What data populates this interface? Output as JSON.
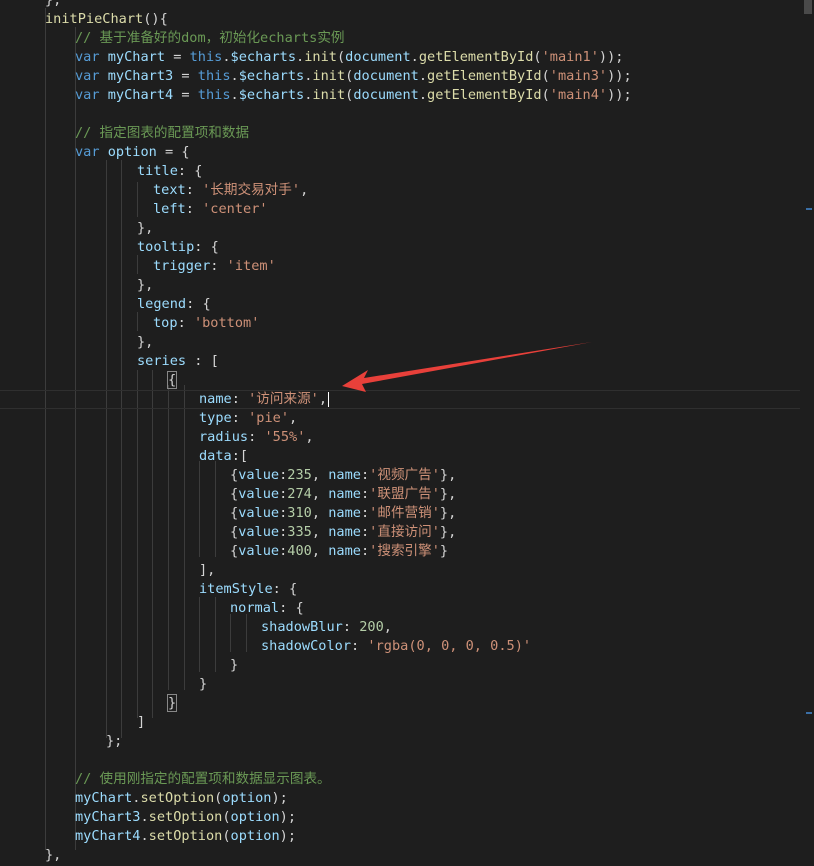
{
  "lines": [
    [
      {
        "t": "},",
        "c": "punc"
      }
    ],
    [
      {
        "t": "initPieChart",
        "c": "fn"
      },
      {
        "t": "(){",
        "c": "punc"
      }
    ],
    [
      {
        "t": "// 基于准备好的dom，初始化echarts实例",
        "c": "cmt"
      }
    ],
    [
      {
        "t": "var ",
        "c": "kw"
      },
      {
        "t": "myChart",
        "c": "var"
      },
      {
        "t": " = ",
        "c": "punc"
      },
      {
        "t": "this",
        "c": "kw"
      },
      {
        "t": ".",
        "c": "punc"
      },
      {
        "t": "$echarts",
        "c": "var"
      },
      {
        "t": ".",
        "c": "punc"
      },
      {
        "t": "init",
        "c": "fn"
      },
      {
        "t": "(",
        "c": "punc"
      },
      {
        "t": "document",
        "c": "var"
      },
      {
        "t": ".",
        "c": "punc"
      },
      {
        "t": "getElementById",
        "c": "fn"
      },
      {
        "t": "(",
        "c": "punc"
      },
      {
        "t": "'main1'",
        "c": "str"
      },
      {
        "t": "));",
        "c": "punc"
      }
    ],
    [
      {
        "t": "var ",
        "c": "kw"
      },
      {
        "t": "myChart3",
        "c": "var"
      },
      {
        "t": " = ",
        "c": "punc"
      },
      {
        "t": "this",
        "c": "kw"
      },
      {
        "t": ".",
        "c": "punc"
      },
      {
        "t": "$echarts",
        "c": "var"
      },
      {
        "t": ".",
        "c": "punc"
      },
      {
        "t": "init",
        "c": "fn"
      },
      {
        "t": "(",
        "c": "punc"
      },
      {
        "t": "document",
        "c": "var"
      },
      {
        "t": ".",
        "c": "punc"
      },
      {
        "t": "getElementById",
        "c": "fn"
      },
      {
        "t": "(",
        "c": "punc"
      },
      {
        "t": "'main3'",
        "c": "str"
      },
      {
        "t": "));",
        "c": "punc"
      }
    ],
    [
      {
        "t": "var ",
        "c": "kw"
      },
      {
        "t": "myChart4",
        "c": "var"
      },
      {
        "t": " = ",
        "c": "punc"
      },
      {
        "t": "this",
        "c": "kw"
      },
      {
        "t": ".",
        "c": "punc"
      },
      {
        "t": "$echarts",
        "c": "var"
      },
      {
        "t": ".",
        "c": "punc"
      },
      {
        "t": "init",
        "c": "fn"
      },
      {
        "t": "(",
        "c": "punc"
      },
      {
        "t": "document",
        "c": "var"
      },
      {
        "t": ".",
        "c": "punc"
      },
      {
        "t": "getElementById",
        "c": "fn"
      },
      {
        "t": "(",
        "c": "punc"
      },
      {
        "t": "'main4'",
        "c": "str"
      },
      {
        "t": "));",
        "c": "punc"
      }
    ],
    [],
    [
      {
        "t": "// 指定图表的配置项和数据",
        "c": "cmt"
      }
    ],
    [
      {
        "t": "var ",
        "c": "kw"
      },
      {
        "t": "option",
        "c": "var"
      },
      {
        "t": " = {",
        "c": "punc"
      }
    ],
    [
      {
        "t": "title",
        "c": "var"
      },
      {
        "t": ": {",
        "c": "punc"
      }
    ],
    [
      {
        "t": "text",
        "c": "var"
      },
      {
        "t": ": ",
        "c": "punc"
      },
      {
        "t": "'长期交易对手'",
        "c": "str"
      },
      {
        "t": ",",
        "c": "punc"
      }
    ],
    [
      {
        "t": "left",
        "c": "var"
      },
      {
        "t": ": ",
        "c": "punc"
      },
      {
        "t": "'center'",
        "c": "str"
      }
    ],
    [
      {
        "t": "},",
        "c": "punc"
      }
    ],
    [
      {
        "t": "tooltip",
        "c": "var"
      },
      {
        "t": ": {",
        "c": "punc"
      }
    ],
    [
      {
        "t": "trigger",
        "c": "var"
      },
      {
        "t": ": ",
        "c": "punc"
      },
      {
        "t": "'item'",
        "c": "str"
      }
    ],
    [
      {
        "t": "},",
        "c": "punc"
      }
    ],
    [
      {
        "t": "legend",
        "c": "var"
      },
      {
        "t": ": {",
        "c": "punc"
      }
    ],
    [
      {
        "t": "top",
        "c": "var"
      },
      {
        "t": ": ",
        "c": "punc"
      },
      {
        "t": "'bottom'",
        "c": "str"
      }
    ],
    [
      {
        "t": "},",
        "c": "punc"
      }
    ],
    [
      {
        "t": "series",
        "c": "var"
      },
      {
        "t": " : [",
        "c": "punc"
      }
    ],
    [
      {
        "t": "{",
        "c": "punc"
      }
    ],
    [
      {
        "t": "name",
        "c": "var"
      },
      {
        "t": ": ",
        "c": "punc"
      },
      {
        "t": "'访问来源'",
        "c": "str"
      },
      {
        "t": ",",
        "c": "punc"
      }
    ],
    [
      {
        "t": "type",
        "c": "var"
      },
      {
        "t": ": ",
        "c": "punc"
      },
      {
        "t": "'pie'",
        "c": "str"
      },
      {
        "t": ",",
        "c": "punc"
      }
    ],
    [
      {
        "t": "radius",
        "c": "var"
      },
      {
        "t": ": ",
        "c": "punc"
      },
      {
        "t": "'55%'",
        "c": "str"
      },
      {
        "t": ",",
        "c": "punc"
      }
    ],
    [
      {
        "t": "data",
        "c": "var"
      },
      {
        "t": ":[",
        "c": "punc"
      }
    ],
    [
      {
        "t": "{",
        "c": "punc"
      },
      {
        "t": "value",
        "c": "var"
      },
      {
        "t": ":",
        "c": "punc"
      },
      {
        "t": "235",
        "c": "num"
      },
      {
        "t": ", ",
        "c": "punc"
      },
      {
        "t": "name",
        "c": "var"
      },
      {
        "t": ":",
        "c": "punc"
      },
      {
        "t": "'视频广告'",
        "c": "str"
      },
      {
        "t": "},",
        "c": "punc"
      }
    ],
    [
      {
        "t": "{",
        "c": "punc"
      },
      {
        "t": "value",
        "c": "var"
      },
      {
        "t": ":",
        "c": "punc"
      },
      {
        "t": "274",
        "c": "num"
      },
      {
        "t": ", ",
        "c": "punc"
      },
      {
        "t": "name",
        "c": "var"
      },
      {
        "t": ":",
        "c": "punc"
      },
      {
        "t": "'联盟广告'",
        "c": "str"
      },
      {
        "t": "},",
        "c": "punc"
      }
    ],
    [
      {
        "t": "{",
        "c": "punc"
      },
      {
        "t": "value",
        "c": "var"
      },
      {
        "t": ":",
        "c": "punc"
      },
      {
        "t": "310",
        "c": "num"
      },
      {
        "t": ", ",
        "c": "punc"
      },
      {
        "t": "name",
        "c": "var"
      },
      {
        "t": ":",
        "c": "punc"
      },
      {
        "t": "'邮件营销'",
        "c": "str"
      },
      {
        "t": "},",
        "c": "punc"
      }
    ],
    [
      {
        "t": "{",
        "c": "punc"
      },
      {
        "t": "value",
        "c": "var"
      },
      {
        "t": ":",
        "c": "punc"
      },
      {
        "t": "335",
        "c": "num"
      },
      {
        "t": ", ",
        "c": "punc"
      },
      {
        "t": "name",
        "c": "var"
      },
      {
        "t": ":",
        "c": "punc"
      },
      {
        "t": "'直接访问'",
        "c": "str"
      },
      {
        "t": "},",
        "c": "punc"
      }
    ],
    [
      {
        "t": "{",
        "c": "punc"
      },
      {
        "t": "value",
        "c": "var"
      },
      {
        "t": ":",
        "c": "punc"
      },
      {
        "t": "400",
        "c": "num"
      },
      {
        "t": ", ",
        "c": "punc"
      },
      {
        "t": "name",
        "c": "var"
      },
      {
        "t": ":",
        "c": "punc"
      },
      {
        "t": "'搜索引擎'",
        "c": "str"
      },
      {
        "t": "}",
        "c": "punc"
      }
    ],
    [
      {
        "t": "],",
        "c": "punc"
      }
    ],
    [
      {
        "t": "itemStyle",
        "c": "var"
      },
      {
        "t": ": {",
        "c": "punc"
      }
    ],
    [
      {
        "t": "normal",
        "c": "var"
      },
      {
        "t": ": {",
        "c": "punc"
      }
    ],
    [
      {
        "t": "shadowBlur",
        "c": "var"
      },
      {
        "t": ": ",
        "c": "punc"
      },
      {
        "t": "200",
        "c": "num"
      },
      {
        "t": ",",
        "c": "punc"
      }
    ],
    [
      {
        "t": "shadowColor",
        "c": "var"
      },
      {
        "t": ": ",
        "c": "punc"
      },
      {
        "t": "'rgba(0, 0, 0, 0.5)'",
        "c": "str"
      }
    ],
    [
      {
        "t": "}",
        "c": "punc"
      }
    ],
    [
      {
        "t": "}",
        "c": "punc"
      }
    ],
    [
      {
        "t": "}",
        "c": "punc"
      }
    ],
    [
      {
        "t": "]",
        "c": "punc"
      }
    ],
    [
      {
        "t": "};",
        "c": "punc"
      }
    ],
    [],
    [
      {
        "t": "// 使用刚指定的配置项和数据显示图表。",
        "c": "cmt"
      }
    ],
    [
      {
        "t": "myChart",
        "c": "var"
      },
      {
        "t": ".",
        "c": "punc"
      },
      {
        "t": "setOption",
        "c": "fn"
      },
      {
        "t": "(",
        "c": "punc"
      },
      {
        "t": "option",
        "c": "var"
      },
      {
        "t": ");",
        "c": "punc"
      }
    ],
    [
      {
        "t": "myChart3",
        "c": "var"
      },
      {
        "t": ".",
        "c": "punc"
      },
      {
        "t": "setOption",
        "c": "fn"
      },
      {
        "t": "(",
        "c": "punc"
      },
      {
        "t": "option",
        "c": "var"
      },
      {
        "t": ");",
        "c": "punc"
      }
    ],
    [
      {
        "t": "myChart4",
        "c": "var"
      },
      {
        "t": ".",
        "c": "punc"
      },
      {
        "t": "setOption",
        "c": "fn"
      },
      {
        "t": "(",
        "c": "punc"
      },
      {
        "t": "option",
        "c": "var"
      },
      {
        "t": ");",
        "c": "punc"
      }
    ],
    [
      {
        "t": "},",
        "c": "punc"
      }
    ]
  ],
  "current_line": 21,
  "annotation": {
    "color": "#e8403a"
  }
}
